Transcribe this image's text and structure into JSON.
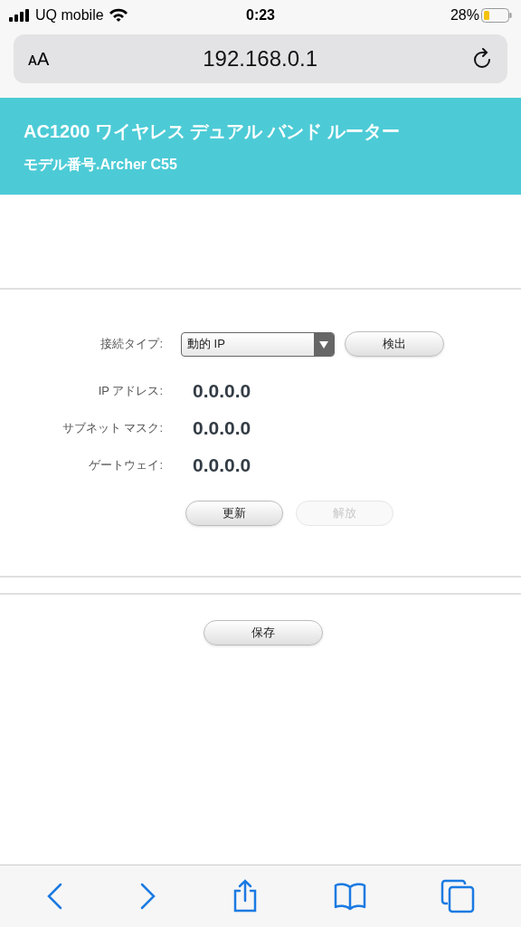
{
  "status_bar": {
    "carrier": "UQ mobile",
    "time": "0:23",
    "battery": "28%"
  },
  "address_bar": {
    "text_size": "ᴀA",
    "url": "192.168.0.1"
  },
  "header": {
    "title": "AC1200 ワイヤレス デュアル バンド ルーター",
    "model": "モデル番号.Archer C55"
  },
  "connection": {
    "label": "接続タイプ:",
    "value": "動的 IP",
    "button": {
      "label": "検出",
      "disabled": false
    }
  },
  "fields": [
    {
      "label": "IP アドレス:",
      "value": "0.0.0.0"
    },
    {
      "label": "サブネット マスク:",
      "value": "0.0.0.0"
    },
    {
      "label": "ゲートウェイ:",
      "value": "0.0.0.0"
    }
  ],
  "actions": [
    {
      "label": "更新",
      "disabled": false
    },
    {
      "label": "解放",
      "disabled": true
    }
  ],
  "save": {
    "label": "保存",
    "disabled": false
  }
}
